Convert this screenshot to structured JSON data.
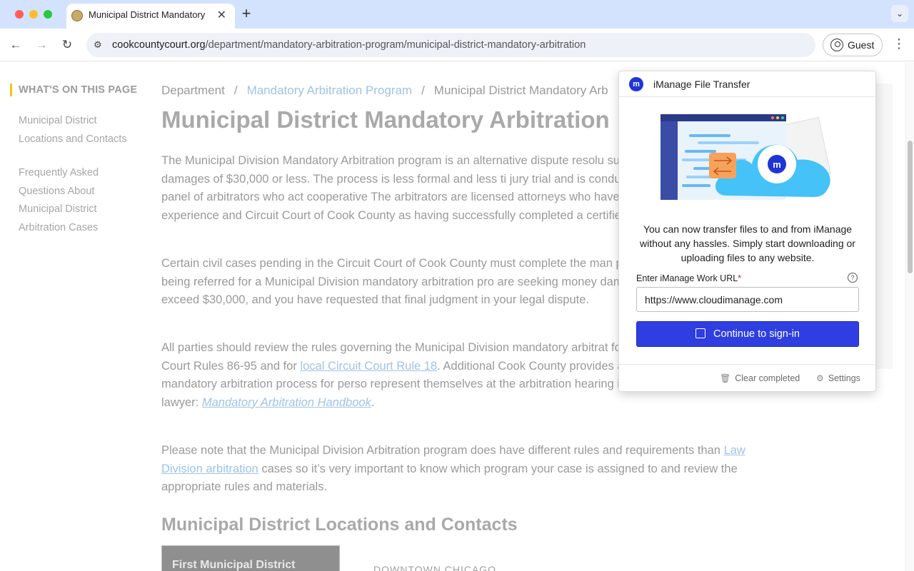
{
  "browser": {
    "tab_title": "Municipal District Mandatory Arbitration",
    "new_tab": "+",
    "url_domain": "cookcountycourt.org",
    "url_path": "/department/mandatory-arbitration-program/municipal-district-mandatory-arbitration",
    "profile_label": "Guest"
  },
  "toc": {
    "heading": "WHAT'S ON THIS PAGE",
    "group1": [
      "Municipal District",
      "Locations and Contacts"
    ],
    "group2": [
      "Frequently Asked",
      "Questions About",
      "Municipal District",
      "Arbitration Cases"
    ]
  },
  "breadcrumb": {
    "root": "Department",
    "sep": "/",
    "parent": "Mandatory Arbitration Program",
    "current": "Municipal District Mandatory Arb"
  },
  "page": {
    "title": "Municipal District Mandatory Arbitration",
    "p1": "The Municipal Division Mandatory Arbitration program is an alternative dispute resolu suits seeking money damages of $30,000 or less. The process is less formal and less ti jury trial and is conducted by a three-member panel of arbitrators who act cooperative The arbitrators are licensed attorneys who have at least three years of experience and Circuit Court of Cook County as having successfully completed a certified course in arb",
    "p2": "Certain civil cases pending in the Circuit Court of Cook County must complete the man process. Your case is being referred for a Municipal Division mandatory arbitration pro are seeking money damages that do not exceed $30,000, and you have requested that final judgment in your legal dispute.",
    "p3_a": "All parties should review the rules governing the Municipal Division mandatory arbitrat for a copy of Supreme Court Rules 86-95 and for ",
    "p3_link": "local Circuit Court Rule 18",
    "p3_b": ". Additional Cook County provides a general guide on the mandatory arbitration process for perso represent themselves at the arbitration hearing instead of retaining a lawyer: ",
    "p3_link2": "Mandatory Arbitration Handbook",
    "p3_c": ".",
    "p4_a": "Please note that the Municipal Division Arbitration program does have different rules and requirements than ",
    "p4_link": "Law Division arbitration",
    "p4_b": " cases so it’s very important to know which program your case is assigned to and review the appropriate rules and materials.",
    "section_title": "Municipal District Locations and Contacts",
    "district_card": "First Municipal District",
    "downtown": "DOWNTOWN CHICAGO"
  },
  "popup": {
    "title": "iManage File Transfer",
    "logo_letter": "m",
    "description": "You can now transfer files to and from iManage without any hassles. Simply start downloading or uploading files to any website.",
    "url_label": "Enter iManage Work URL",
    "required_mark": "*",
    "help": "?",
    "url_value": "https://www.cloudimanage.com",
    "signin_label": "Continue to sign-in",
    "clear_label": "Clear completed",
    "settings_label": "Settings",
    "brand_color": "#2e3ee0"
  }
}
